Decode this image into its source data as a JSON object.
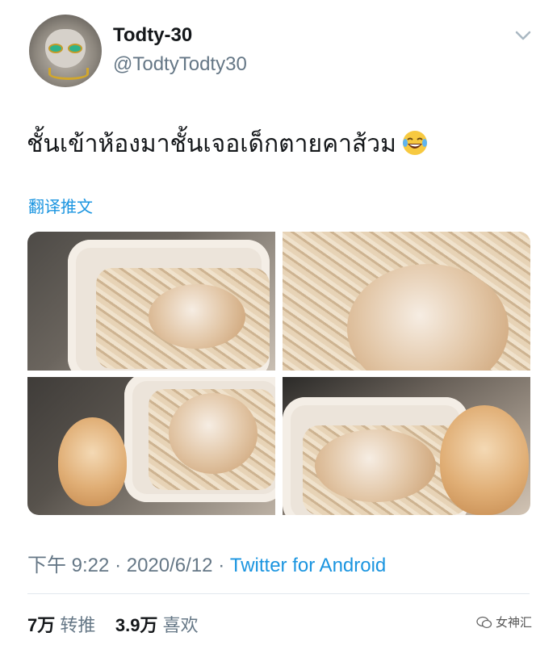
{
  "author": {
    "display_name": "Todty-30",
    "handle": "@TodtyTodty30",
    "avatar_icon": "cat-with-sunglasses-avatar"
  },
  "menu": {
    "icon": "chevron-down-icon"
  },
  "tweet": {
    "text": "ชั้นเข้าห้องมาชั้นเจอเด็กตายคาส้วม",
    "emoji": "face-with-tears-of-joy-icon",
    "translate_label": "翻译推文"
  },
  "photos": [
    {
      "icon": "cat-in-litter-box-photo"
    },
    {
      "icon": "cat-face-in-litter-photo"
    },
    {
      "icon": "kitten-beside-litter-box-photo"
    },
    {
      "icon": "cat-sleeping-in-litter-box-photo"
    }
  ],
  "meta": {
    "time": "下午 9:22",
    "separator": "·",
    "date": "2020/6/12",
    "source": "Twitter for Android"
  },
  "stats": {
    "retweets_count": "7万",
    "retweets_label": "转推",
    "likes_count": "3.9万",
    "likes_label": "喜欢"
  },
  "watermark": {
    "text": "女神汇"
  },
  "colors": {
    "link": "#1b95e0",
    "secondary": "#657786",
    "primary": "#14171a"
  }
}
